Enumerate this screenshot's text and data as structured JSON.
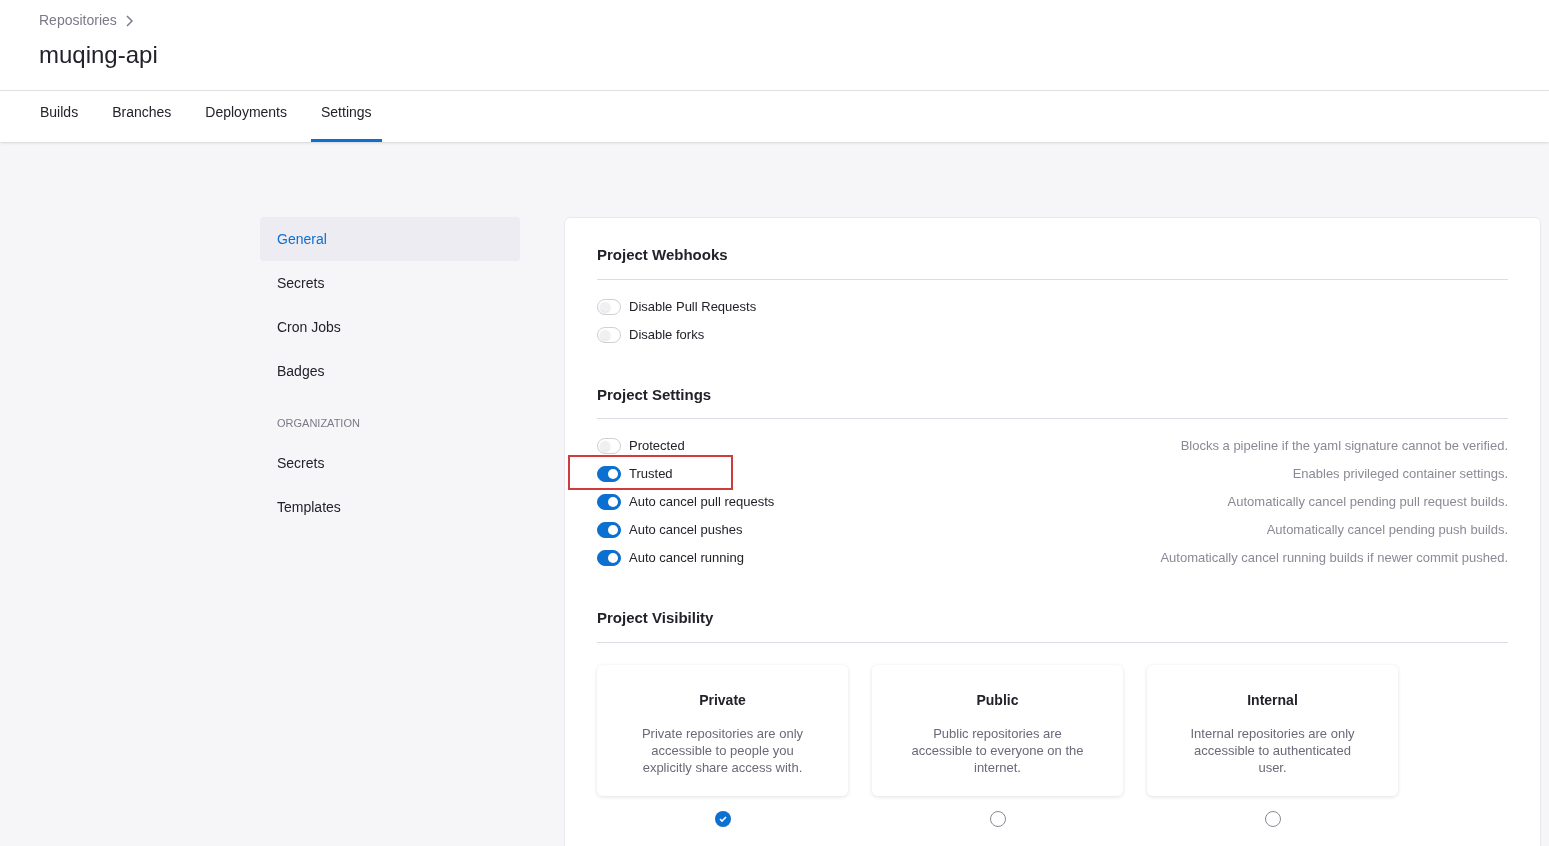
{
  "breadcrumb": "Repositories",
  "title": "muqing-api",
  "tabs": [
    {
      "label": "Builds",
      "selected": false
    },
    {
      "label": "Branches",
      "selected": false
    },
    {
      "label": "Deployments",
      "selected": false
    },
    {
      "label": "Settings",
      "selected": true
    }
  ],
  "sidebar": {
    "items": [
      {
        "label": "General",
        "selected": true
      },
      {
        "label": "Secrets",
        "selected": false
      },
      {
        "label": "Cron Jobs",
        "selected": false
      },
      {
        "label": "Badges",
        "selected": false
      }
    ],
    "section_label": "ORGANIZATION",
    "org_items": [
      {
        "label": "Secrets",
        "selected": false
      },
      {
        "label": "Templates",
        "selected": false
      }
    ]
  },
  "webhooks": {
    "title": "Project Webhooks",
    "toggles": [
      {
        "label": "Disable Pull Requests",
        "on": false
      },
      {
        "label": "Disable forks",
        "on": false
      }
    ]
  },
  "settings": {
    "title": "Project Settings",
    "toggles": [
      {
        "label": "Protected",
        "on": false,
        "highlighted": false,
        "description": "Blocks a pipeline if the yaml signature cannot be verified."
      },
      {
        "label": "Trusted",
        "on": true,
        "highlighted": true,
        "description": "Enables privileged container settings."
      },
      {
        "label": "Auto cancel pull requests",
        "on": true,
        "highlighted": false,
        "description": "Automatically cancel pending pull request builds."
      },
      {
        "label": "Auto cancel pushes",
        "on": true,
        "highlighted": false,
        "description": "Automatically cancel pending push builds."
      },
      {
        "label": "Auto cancel running",
        "on": true,
        "highlighted": false,
        "description": "Automatically cancel running builds if newer commit pushed."
      }
    ]
  },
  "visibility": {
    "title": "Project Visibility",
    "options": [
      {
        "title": "Private",
        "description": "Private repositories are only accessible to people you explicitly share access with.",
        "selected": true
      },
      {
        "title": "Public",
        "description": "Public repositories are accessible to everyone on the internet.",
        "selected": false
      },
      {
        "title": "Internal",
        "description": "Internal repositories are only accessible to authenticated user.",
        "selected": false
      }
    ]
  }
}
